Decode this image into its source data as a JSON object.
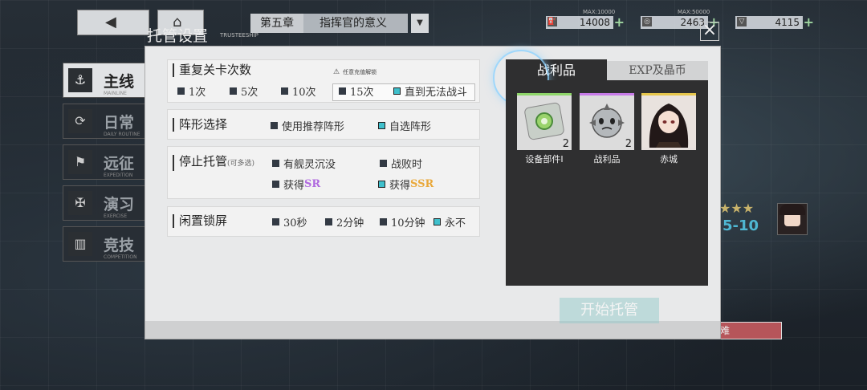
{
  "header": {
    "chapter_number": "第五章",
    "chapter_name": "指挥官的意义",
    "resources": [
      {
        "max": "MAX:10000",
        "value": "14008"
      },
      {
        "max": "MAX:50000",
        "value": "2463"
      },
      {
        "max": "",
        "value": "4115"
      }
    ]
  },
  "sidebar": {
    "items": [
      {
        "label": "主线",
        "sub": "MAINLINE"
      },
      {
        "label": "日常",
        "sub": "DAILY ROUTINE"
      },
      {
        "label": "远征",
        "sub": "EXPEDITION"
      },
      {
        "label": "演习",
        "sub": "EXERCISE"
      },
      {
        "label": "竞技",
        "sub": "COMPETITION"
      }
    ]
  },
  "dialog": {
    "title": "托管设置",
    "subtitle": "TRUSTEESHIP",
    "repeat": {
      "title": "重复关卡次数",
      "warning": "任意充值解锁",
      "options": [
        "1次",
        "5次",
        "10次",
        "15次",
        "直到无法战斗"
      ]
    },
    "formation": {
      "title": "阵形选择",
      "options": [
        "使用推荐阵形",
        "自选阵形"
      ]
    },
    "stop": {
      "title": "停止托管",
      "hint": "(可多选)",
      "opt1": "有舰灵沉没",
      "opt2": "战败时",
      "opt3_prefix": "获得",
      "opt3_tag": "SR",
      "opt4_prefix": "获得",
      "opt4_tag": "SSR"
    },
    "idle": {
      "title": "闲置锁屏",
      "options": [
        "30秒",
        "2分钟",
        "10分钟",
        "永不"
      ]
    },
    "tabs": [
      "战利品",
      "EXP及晶币"
    ],
    "loot": [
      {
        "name": "设备部件I",
        "count": "2"
      },
      {
        "name": "战利品",
        "count": "2"
      },
      {
        "name": "赤城",
        "count": ""
      }
    ],
    "start_label": "开始托管"
  },
  "map": {
    "stage": "5-10",
    "difficulty": "难"
  },
  "colors": {
    "selected": "#3fc0cc",
    "sr": "#b06adf",
    "ssr": "#e9a83a",
    "stage": "#4fb7d2"
  }
}
